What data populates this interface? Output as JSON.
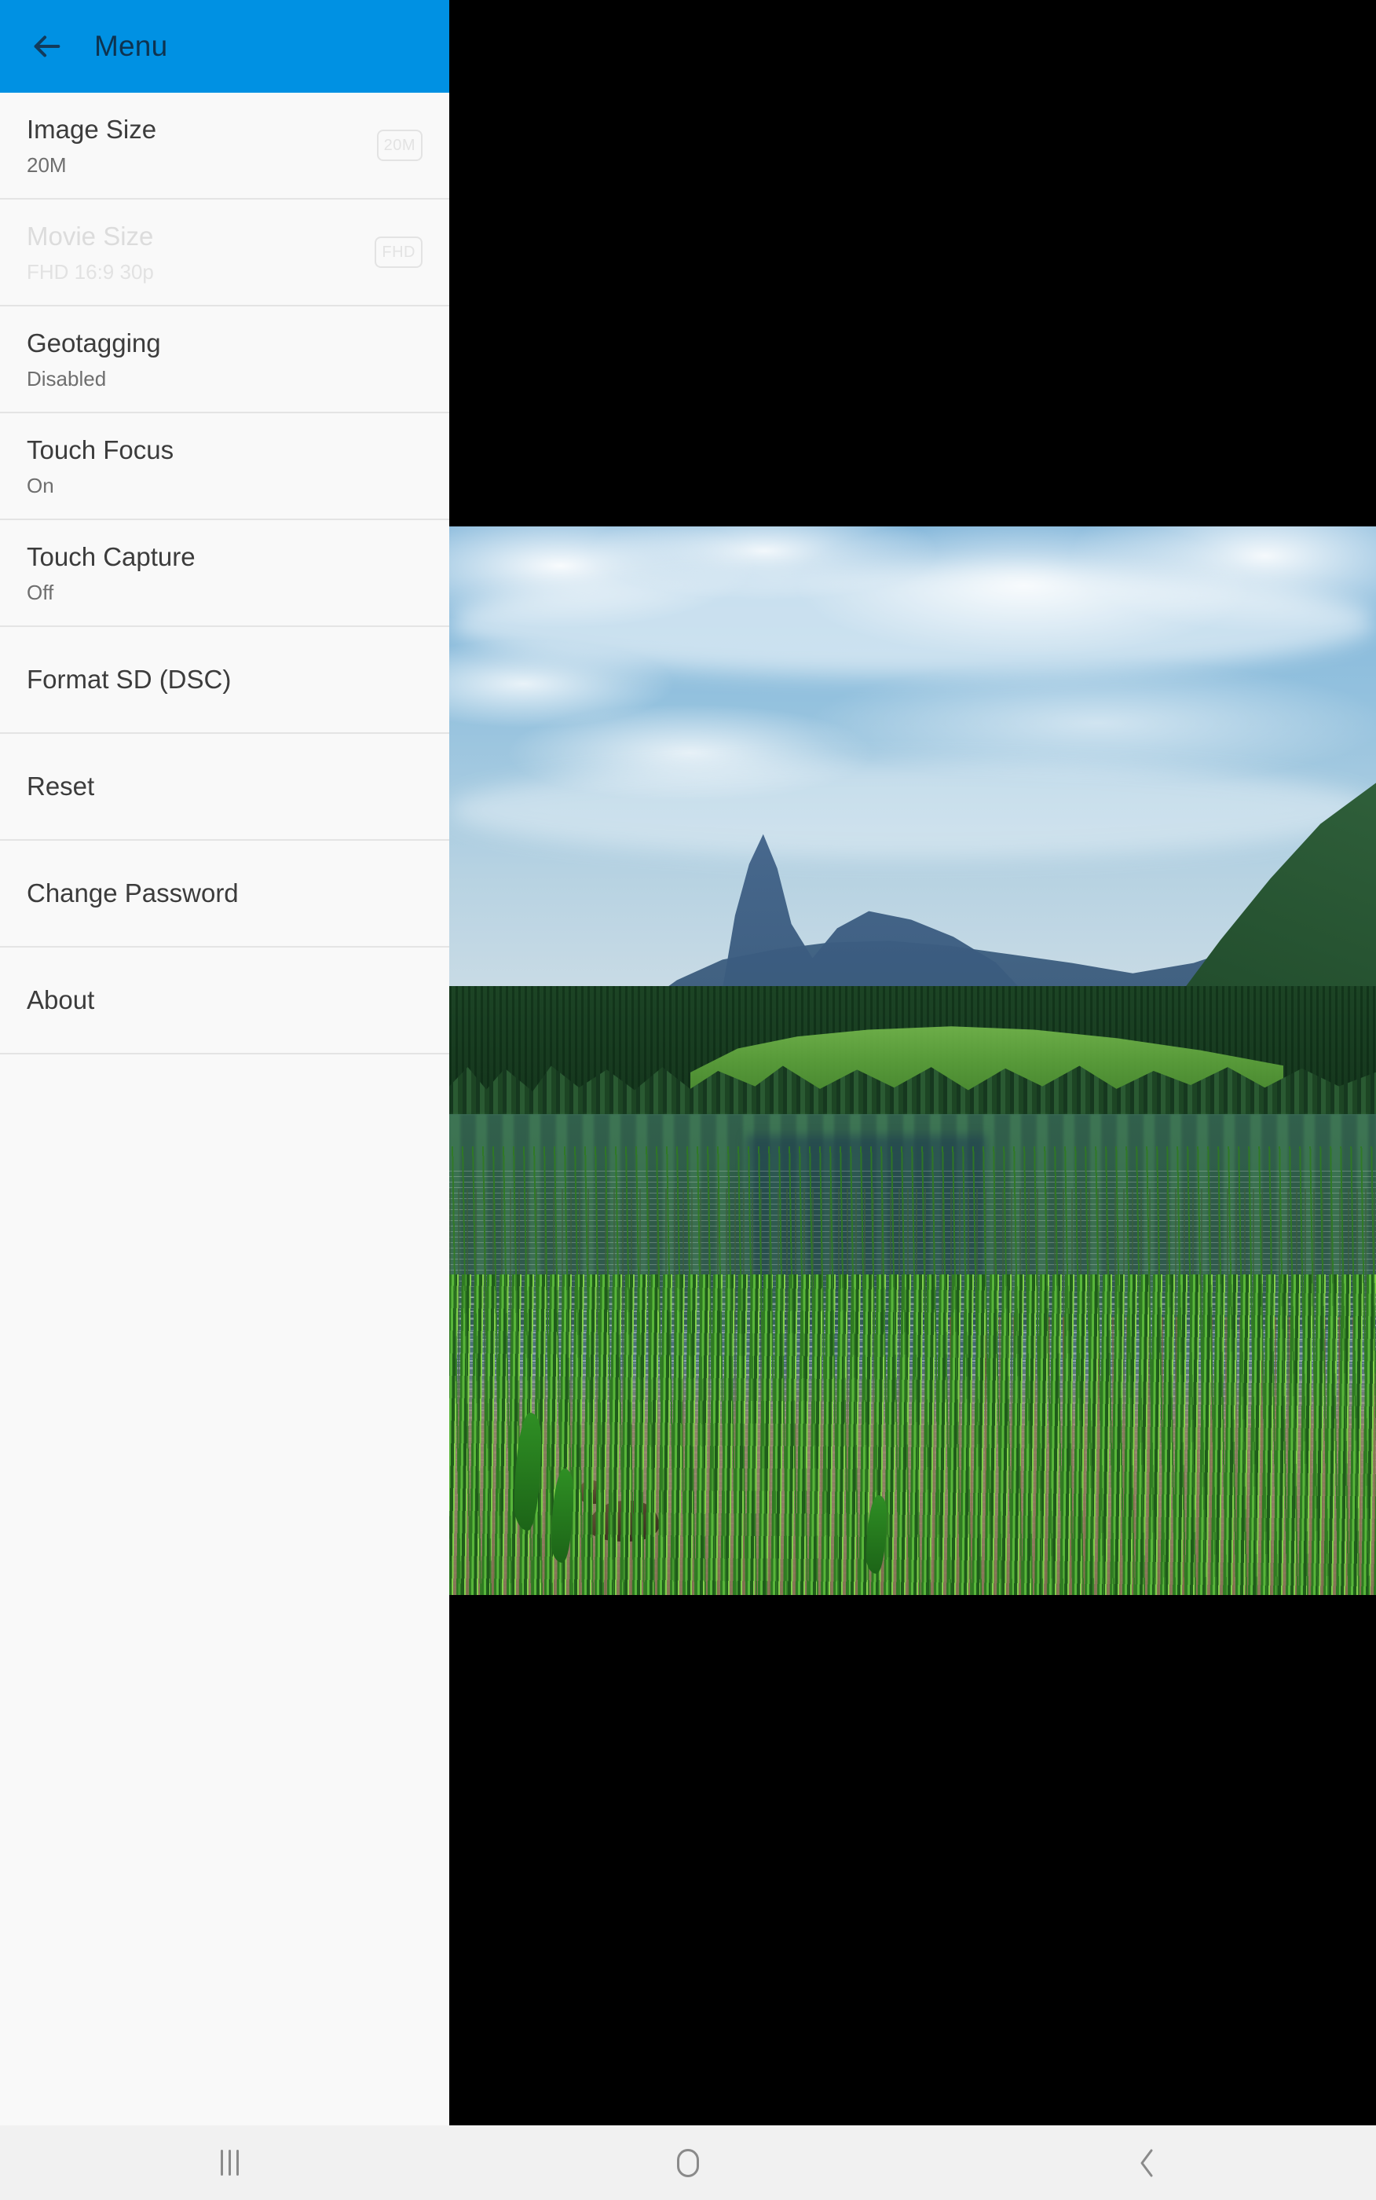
{
  "app": {
    "appbar": {
      "back_icon": "arrow-left-icon",
      "title": "Menu",
      "background_color": "#0091E3",
      "title_color": "#0E3350"
    },
    "drawer_background": "#F9F9F9",
    "divider_color": "#E4E4E4"
  },
  "menu": {
    "items": [
      {
        "title": "Image Size",
        "subtitle": "20M",
        "badge": "20M",
        "disabled": false,
        "type": "two-line"
      },
      {
        "title": "Movie Size",
        "subtitle": "FHD 16:9 30p",
        "badge": "FHD",
        "disabled": true,
        "type": "two-line"
      },
      {
        "title": "Geotagging",
        "subtitle": "Disabled",
        "badge": "",
        "disabled": false,
        "type": "two-line"
      },
      {
        "title": "Touch Focus",
        "subtitle": "On",
        "badge": "",
        "disabled": false,
        "type": "two-line"
      },
      {
        "title": "Touch Capture",
        "subtitle": "Off",
        "badge": "",
        "disabled": false,
        "type": "two-line"
      },
      {
        "title": "Format SD (DSC)",
        "subtitle": "",
        "badge": "",
        "disabled": false,
        "type": "one-line"
      },
      {
        "title": "Reset",
        "subtitle": "",
        "badge": "",
        "disabled": false,
        "type": "one-line"
      },
      {
        "title": "Change Password",
        "subtitle": "",
        "badge": "",
        "disabled": false,
        "type": "one-line"
      },
      {
        "title": "About",
        "subtitle": "",
        "badge": "",
        "disabled": false,
        "type": "one-line"
      }
    ]
  },
  "viewer": {
    "background_color": "#000000",
    "photo_description": "Alpine lake with mountain peak, forested hillsides, green meadow, reed-filled shoreline and a duck",
    "letterbox": true
  },
  "navbar": {
    "background_color": "#F1F1F1",
    "recents_icon": "recents-icon",
    "home_icon": "home-icon",
    "back_icon": "chevron-left-icon"
  }
}
